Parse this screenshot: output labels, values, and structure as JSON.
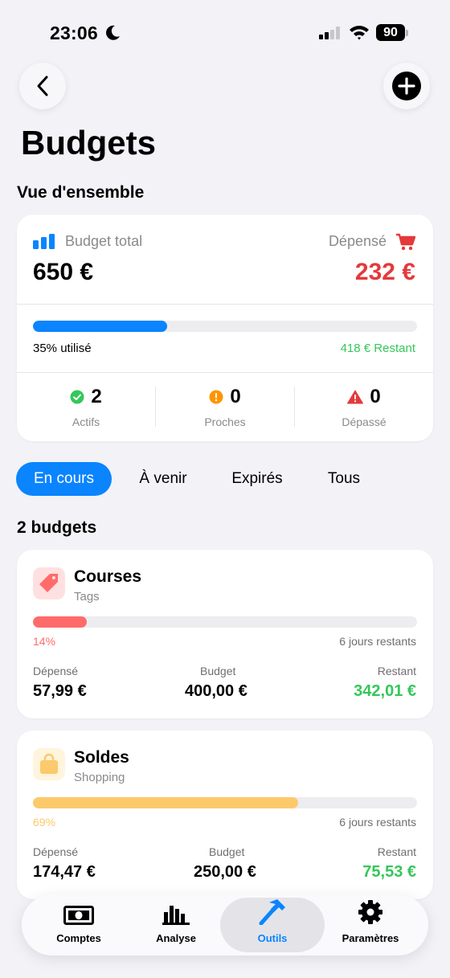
{
  "status_bar": {
    "time": "23:06",
    "battery": "90"
  },
  "page": {
    "title": "Budgets"
  },
  "overview": {
    "section_title": "Vue d'ensemble",
    "total_label": "Budget total",
    "total_value": "650 €",
    "spent_label": "Dépensé",
    "spent_value": "232 €",
    "used_fraction": 0.35,
    "used_text": "35% utilisé",
    "remaining_text": "418 € Restant",
    "stats": [
      {
        "value": "2",
        "label": "Actifs"
      },
      {
        "value": "0",
        "label": "Proches"
      },
      {
        "value": "0",
        "label": "Dépassé"
      }
    ]
  },
  "filters": {
    "tabs": [
      "En cours",
      "À venir",
      "Expirés",
      "Tous"
    ],
    "active": "En cours"
  },
  "budgets_section": {
    "title": "2 budgets"
  },
  "budgets": [
    {
      "name": "Courses",
      "category": "Tags",
      "icon": "tag-icon",
      "fraction": 0.14,
      "percent_text": "14%",
      "days_text": "6 jours restants",
      "spent_label": "Dépensé",
      "spent": "57,99 €",
      "budget_label": "Budget",
      "budget": "400,00 €",
      "remaining_label": "Restant",
      "remaining": "342,01 €",
      "color": "#ff6b6b"
    },
    {
      "name": "Soldes",
      "category": "Shopping",
      "icon": "shopping-bag-icon",
      "fraction": 0.69,
      "percent_text": "69%",
      "days_text": "6 jours restants",
      "spent_label": "Dépensé",
      "spent": "174,47 €",
      "budget_label": "Budget",
      "budget": "250,00 €",
      "remaining_label": "Restant",
      "remaining": "75,53 €",
      "color": "#fcc96b"
    }
  ],
  "tabbar": {
    "items": [
      {
        "label": "Comptes",
        "icon": "banknote-icon"
      },
      {
        "label": "Analyse",
        "icon": "bar-chart-icon"
      },
      {
        "label": "Outils",
        "icon": "hammer-icon"
      },
      {
        "label": "Paramètres",
        "icon": "gear-icon"
      }
    ],
    "active": "Outils"
  },
  "colors": {
    "accent": "#0a84ff",
    "danger": "#e5393a",
    "success": "#34c759",
    "warning": "#ff9500"
  }
}
